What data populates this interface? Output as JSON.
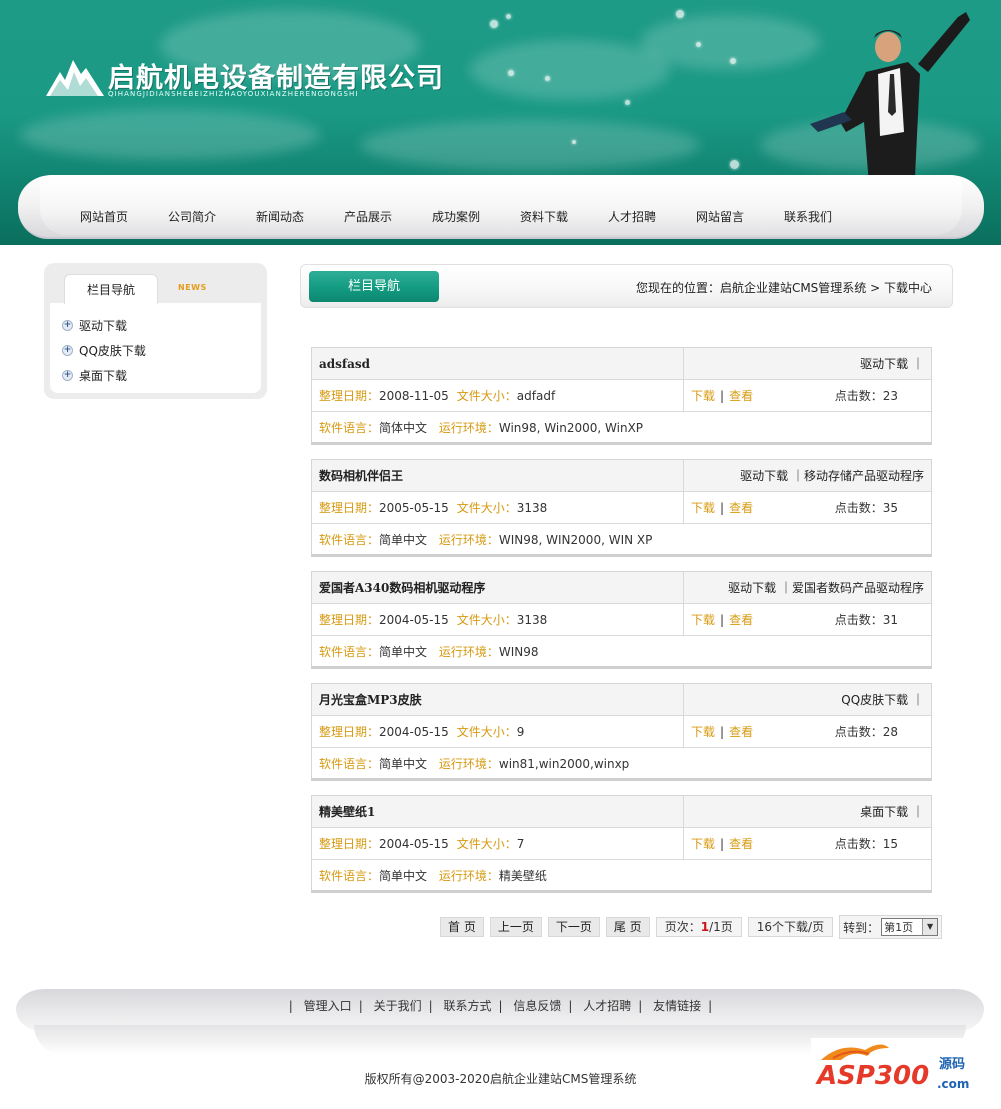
{
  "header": {
    "company_name": "启航机电设备制造有限公司",
    "company_pinyin": "QIHANGJIDIANSHEBEIZHIZHAOYOUXIANZHERENGONGSHI"
  },
  "nav": [
    "网站首页",
    "公司简介",
    "新闻动态",
    "产品展示",
    "成功案例",
    "资料下载",
    "人才招聘",
    "网站留言",
    "联系我们"
  ],
  "sidebar": {
    "tab_label": "栏目导航",
    "news_label": "NEWS",
    "items": [
      "驱动下载",
      "QQ皮肤下载",
      "桌面下载"
    ]
  },
  "titlebar": {
    "tab_label": "栏目导航",
    "breadcrumb": "您现在的位置：启航企业建站CMS管理系统 > 下载中心"
  },
  "labels": {
    "date": "整理日期：",
    "size": "文件大小：",
    "lang": "软件语言：",
    "env": "运行环境：",
    "download": "下载",
    "view": "查看",
    "sep": "|",
    "hits": "点击数："
  },
  "downloads": [
    {
      "name": "adsfasd",
      "category": "驱动下载 ｜",
      "date": "2008-11-05",
      "size": "adfadf",
      "hits": "23",
      "lang": "简体中文",
      "env": "Win98, Win2000, WinXP"
    },
    {
      "name": "数码相机伴侣王",
      "category": "驱动下载 ｜移动存储产品驱动程序",
      "date": "2005-05-15",
      "size": "3138",
      "hits": "35",
      "lang": "简单中文",
      "env": "WIN98, WIN2000, WIN XP"
    },
    {
      "name": "爱国者A340数码相机驱动程序",
      "category": "驱动下载 ｜爱国者数码产品驱动程序",
      "date": "2004-05-15",
      "size": "3138",
      "hits": "31",
      "lang": "简单中文",
      "env": "WIN98"
    },
    {
      "name": "月光宝盒MP3皮肤",
      "category": "QQ皮肤下载 ｜",
      "date": "2004-05-15",
      "size": "9",
      "hits": "28",
      "lang": "简单中文",
      "env": "win81,win2000,winxp"
    },
    {
      "name": "精美壁纸1",
      "category": "桌面下载 ｜",
      "date": "2004-05-15",
      "size": "7",
      "hits": "15",
      "lang": "简单中文",
      "env": "精美壁纸"
    }
  ],
  "pager": {
    "first": "首 页",
    "prev": "上一页",
    "next": "下一页",
    "last": "尾 页",
    "page_prefix": "页次：",
    "current": "1",
    "total": "/1页",
    "per_page": "16个下载/页",
    "goto_label": "转到：",
    "goto_selected": "第1页"
  },
  "footer": {
    "links": [
      "管理入口",
      "关于我们",
      "联系方式",
      "信息反馈",
      "人才招聘",
      "友情链接"
    ],
    "copyright": "版权所有@2003-2020启航企业建站CMS管理系统"
  },
  "watermark": {
    "brand": "ASP300",
    "sub": "源码",
    "domain": ".com"
  }
}
